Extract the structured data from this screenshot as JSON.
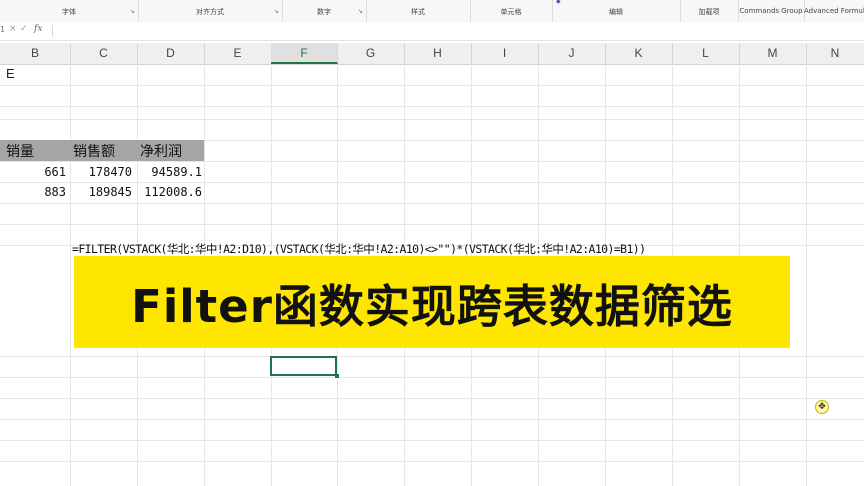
{
  "ribbon": {
    "groups": [
      {
        "label": "字体",
        "launcher": true
      },
      {
        "label": "对齐方式",
        "launcher": true
      },
      {
        "label": "数字",
        "launcher": true
      },
      {
        "label": "样式",
        "launcher": false
      },
      {
        "label": "单元格",
        "launcher": false
      },
      {
        "label": "编辑",
        "launcher": false
      },
      {
        "label": "加载项",
        "launcher": false
      },
      {
        "label": "Commands Group",
        "launcher": false
      },
      {
        "label": "Advanced Formula",
        "launcher": false
      }
    ]
  },
  "formula_bar": {
    "fx_label": "fx",
    "cancel_icon": "×",
    "confirm_icon": "✓",
    "value": ""
  },
  "columns": [
    "B",
    "C",
    "D",
    "E",
    "F",
    "G",
    "H",
    "I",
    "J",
    "K",
    "L",
    "M",
    "N"
  ],
  "selected_column": "F",
  "cells": {
    "b1": "E",
    "header": [
      "销量",
      "销售额",
      "净利润"
    ],
    "rows": [
      [
        "661",
        "178470",
        "94589.1"
      ],
      [
        "883",
        "189845",
        "112008.6"
      ]
    ],
    "formula": "=FILTER(VSTACK(华北:华中!A2:D10),(VSTACK(华北:华中!A2:A10)<>\"\")*(VSTACK(华北:华中!A2:A10)=B1))"
  },
  "banner": {
    "text": "Filter函数实现跨表数据筛选",
    "color": "#ffe600"
  },
  "accent_color": "#217346"
}
